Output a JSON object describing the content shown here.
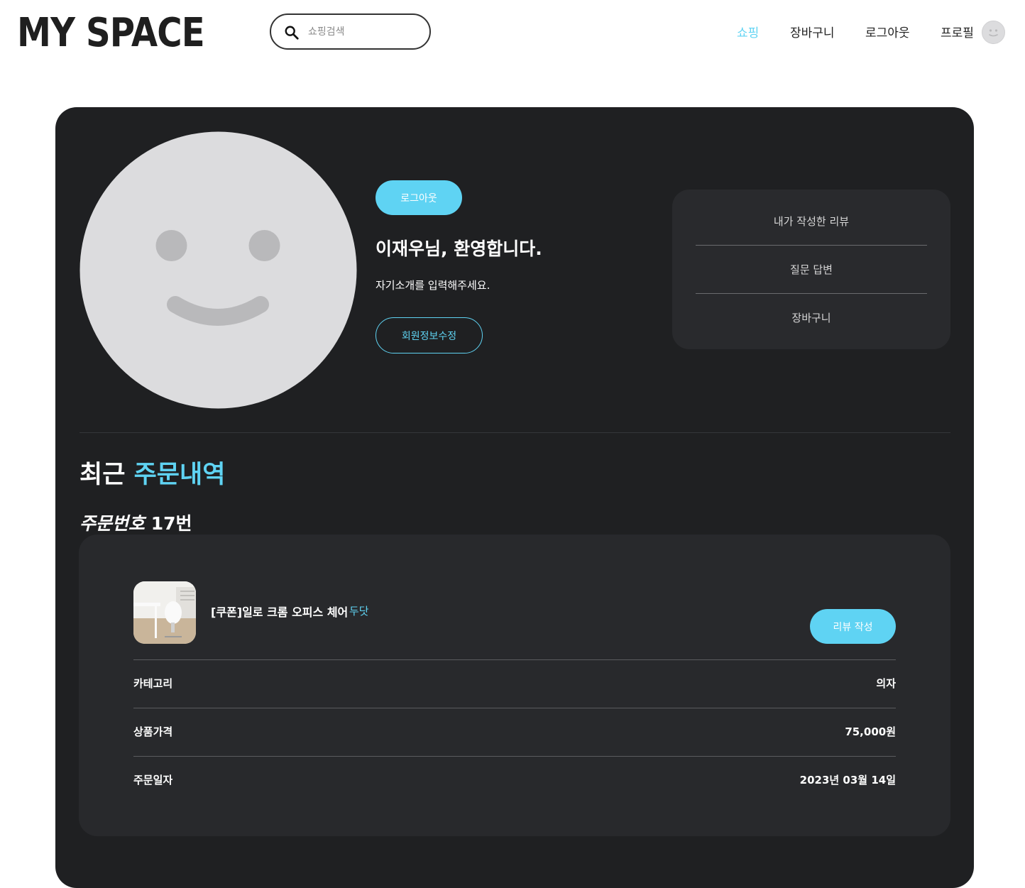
{
  "header": {
    "logo": "MY SPACE",
    "search_placeholder": "쇼핑검색",
    "nav": {
      "shopping": "쇼핑",
      "cart": "장바구니",
      "logout": "로그아웃",
      "profile": "프로필"
    }
  },
  "profile": {
    "logout_button": "로그아웃",
    "welcome": "이재우님, 환영합니다.",
    "intro": "자기소개를 입력해주세요.",
    "edit_button": "회원정보수정"
  },
  "side_menu": {
    "items": [
      "내가 작성한 리뷰",
      "질문 답변",
      "장바구니"
    ]
  },
  "orders": {
    "title_prefix": "최근",
    "title_accent": "주문내역",
    "order_label": "주문번호",
    "order_number": "17번",
    "item": {
      "name": "[쿠폰]일로 크롬 오피스 체어",
      "brand": "두닷",
      "review_button": "리뷰 작성"
    },
    "details": [
      {
        "label": "카테고리",
        "value": "의자"
      },
      {
        "label": "상품가격",
        "value": "75,000원"
      },
      {
        "label": "주문일자",
        "value": "2023년 03월 14일"
      }
    ]
  },
  "colors": {
    "accent": "#5fd3f3",
    "panel": "#1f2022",
    "card": "#28292c",
    "avatar_face": "#dcdcde",
    "avatar_feature": "#b9b9bb"
  }
}
